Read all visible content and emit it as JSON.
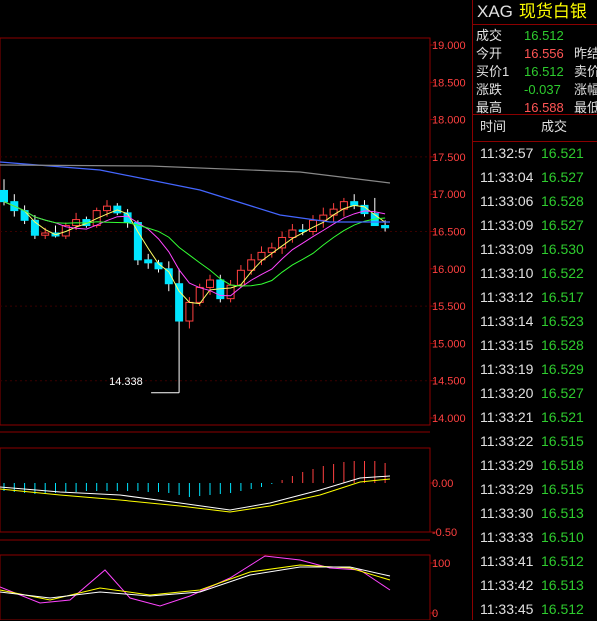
{
  "quote": {
    "symbol": "XAG",
    "name": "现货白银",
    "rows": [
      {
        "label": "成交",
        "value": "16.512",
        "value_color": "#2ecc2e",
        "label2": ""
      },
      {
        "label": "今开",
        "value": "16.556",
        "value_color": "#ff5555",
        "label2": "昨结"
      },
      {
        "label": "买价1",
        "value": "16.512",
        "value_color": "#2ecc2e",
        "label2": "卖价"
      },
      {
        "label": "涨跌",
        "value": "-0.037",
        "value_color": "#2ecc2e",
        "label2": "涨幅"
      },
      {
        "label": "最高",
        "value": "16.588",
        "value_color": "#ff5555",
        "label2": "最低"
      }
    ]
  },
  "ticks": {
    "headers": {
      "time": "时间",
      "price": "成交"
    },
    "rows": [
      {
        "time": "11:32:57",
        "price": "16.521"
      },
      {
        "time": "11:33:04",
        "price": "16.527"
      },
      {
        "time": "11:33:06",
        "price": "16.528"
      },
      {
        "time": "11:33:09",
        "price": "16.527"
      },
      {
        "time": "11:33:09",
        "price": "16.530"
      },
      {
        "time": "11:33:10",
        "price": "16.522"
      },
      {
        "time": "11:33:12",
        "price": "16.517"
      },
      {
        "time": "11:33:14",
        "price": "16.523"
      },
      {
        "time": "11:33:15",
        "price": "16.528"
      },
      {
        "time": "11:33:19",
        "price": "16.529"
      },
      {
        "time": "11:33:20",
        "price": "16.527"
      },
      {
        "time": "11:33:21",
        "price": "16.521"
      },
      {
        "time": "11:33:22",
        "price": "16.515"
      },
      {
        "time": "11:33:29",
        "price": "16.518"
      },
      {
        "time": "11:33:29",
        "price": "16.515"
      },
      {
        "time": "11:33:30",
        "price": "16.513"
      },
      {
        "time": "11:33:33",
        "price": "16.510"
      },
      {
        "time": "11:33:41",
        "price": "16.512"
      },
      {
        "time": "11:33:42",
        "price": "16.513"
      },
      {
        "time": "11:33:45",
        "price": "16.512"
      }
    ]
  },
  "chart": {
    "price_axis": [
      "19.000",
      "18.500",
      "18.000",
      "17.500",
      "17.000",
      "16.500",
      "16.000",
      "15.500",
      "15.000",
      "14.500",
      "14.000"
    ],
    "low_annotation": "14.338",
    "macd_axis": [
      "0.00",
      "-0.50"
    ],
    "kdj_axis": [
      "100",
      "0"
    ],
    "colors": {
      "up": "#ff4040",
      "down": "#00e5ff",
      "grid": "#8b0000",
      "axis_text": "#ff4040"
    }
  },
  "chart_data": {
    "type": "candlestick",
    "ylim": [
      14.0,
      19.0
    ],
    "candles": [
      [
        17.05,
        17.2,
        16.85,
        16.9
      ],
      [
        16.9,
        17.0,
        16.7,
        16.78
      ],
      [
        16.78,
        16.85,
        16.6,
        16.65
      ],
      [
        16.65,
        16.72,
        16.4,
        16.45
      ],
      [
        16.45,
        16.55,
        16.4,
        16.48
      ],
      [
        16.48,
        16.58,
        16.42,
        16.44
      ],
      [
        16.44,
        16.62,
        16.4,
        16.58
      ],
      [
        16.58,
        16.75,
        16.52,
        16.66
      ],
      [
        16.66,
        16.7,
        16.55,
        16.58
      ],
      [
        16.58,
        16.82,
        16.55,
        16.78
      ],
      [
        16.78,
        16.92,
        16.7,
        16.84
      ],
      [
        16.84,
        16.88,
        16.72,
        16.75
      ],
      [
        16.75,
        16.8,
        16.55,
        16.62
      ],
      [
        16.62,
        16.65,
        16.05,
        16.12
      ],
      [
        16.12,
        16.2,
        16.0,
        16.08
      ],
      [
        16.08,
        16.12,
        15.95,
        16.0
      ],
      [
        16.0,
        16.1,
        15.7,
        15.8
      ],
      [
        15.8,
        16.0,
        14.338,
        15.3
      ],
      [
        15.3,
        15.62,
        15.2,
        15.55
      ],
      [
        15.55,
        15.8,
        15.5,
        15.75
      ],
      [
        15.75,
        15.92,
        15.65,
        15.85
      ],
      [
        15.85,
        15.92,
        15.55,
        15.6
      ],
      [
        15.6,
        15.85,
        15.55,
        15.78
      ],
      [
        15.78,
        16.05,
        15.75,
        15.98
      ],
      [
        15.98,
        16.2,
        15.92,
        16.12
      ],
      [
        16.12,
        16.3,
        16.05,
        16.22
      ],
      [
        16.22,
        16.35,
        16.15,
        16.28
      ],
      [
        16.28,
        16.5,
        16.2,
        16.42
      ],
      [
        16.42,
        16.6,
        16.35,
        16.52
      ],
      [
        16.52,
        16.6,
        16.45,
        16.5
      ],
      [
        16.5,
        16.72,
        16.45,
        16.65
      ],
      [
        16.65,
        16.82,
        16.55,
        16.72
      ],
      [
        16.72,
        16.88,
        16.62,
        16.8
      ],
      [
        16.8,
        16.95,
        16.7,
        16.9
      ],
      [
        16.9,
        17.0,
        16.8,
        16.85
      ],
      [
        16.85,
        16.92,
        16.7,
        16.74
      ],
      [
        16.74,
        16.95,
        16.62,
        16.58
      ],
      [
        16.58,
        16.65,
        16.5,
        16.55
      ]
    ]
  }
}
